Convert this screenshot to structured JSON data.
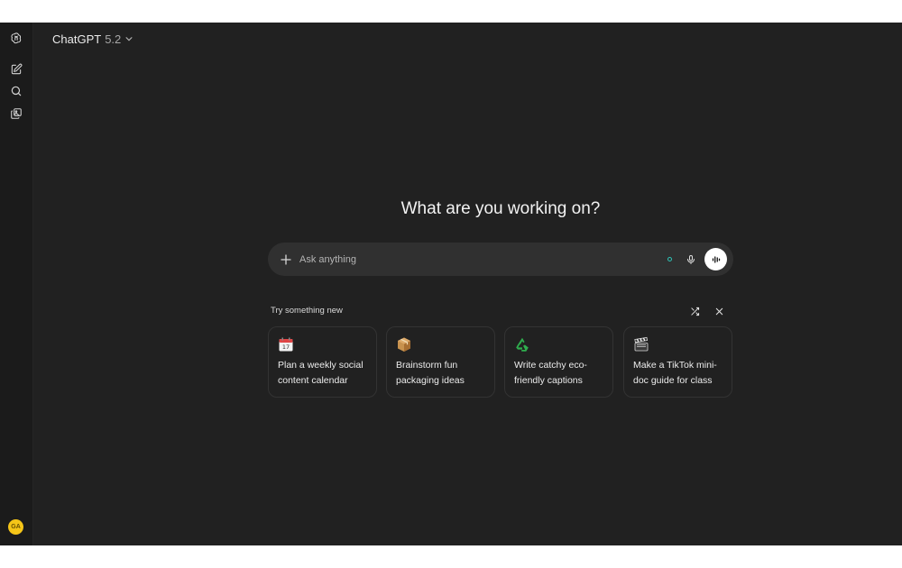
{
  "header": {
    "model_name": "ChatGPT",
    "model_version": "5.2"
  },
  "sidebar": {
    "items": [
      {
        "icon": "openai-logo-icon"
      },
      {
        "icon": "new-chat-icon"
      },
      {
        "icon": "search-icon"
      },
      {
        "icon": "library-icon"
      }
    ],
    "avatar_initials": "GA"
  },
  "main": {
    "heading": "What are you working on?",
    "composer": {
      "placeholder": "Ask anything"
    },
    "suggestions": {
      "label": "Try something new",
      "cards": [
        {
          "icon": "calendar-icon",
          "text": "Plan a weekly social content calendar"
        },
        {
          "icon": "package-icon",
          "text": "Brainstorm fun packaging ideas"
        },
        {
          "icon": "recycle-icon",
          "text": "Write catchy eco-friendly captions"
        },
        {
          "icon": "clapper-board-icon",
          "text": "Make a TikTok mini-doc guide for class"
        }
      ]
    }
  },
  "colors": {
    "background": "#212121",
    "sidebar": "#1b1b1b",
    "composer": "#303030",
    "avatar": "#f5c518",
    "status_dot": "#2ec4b6"
  }
}
